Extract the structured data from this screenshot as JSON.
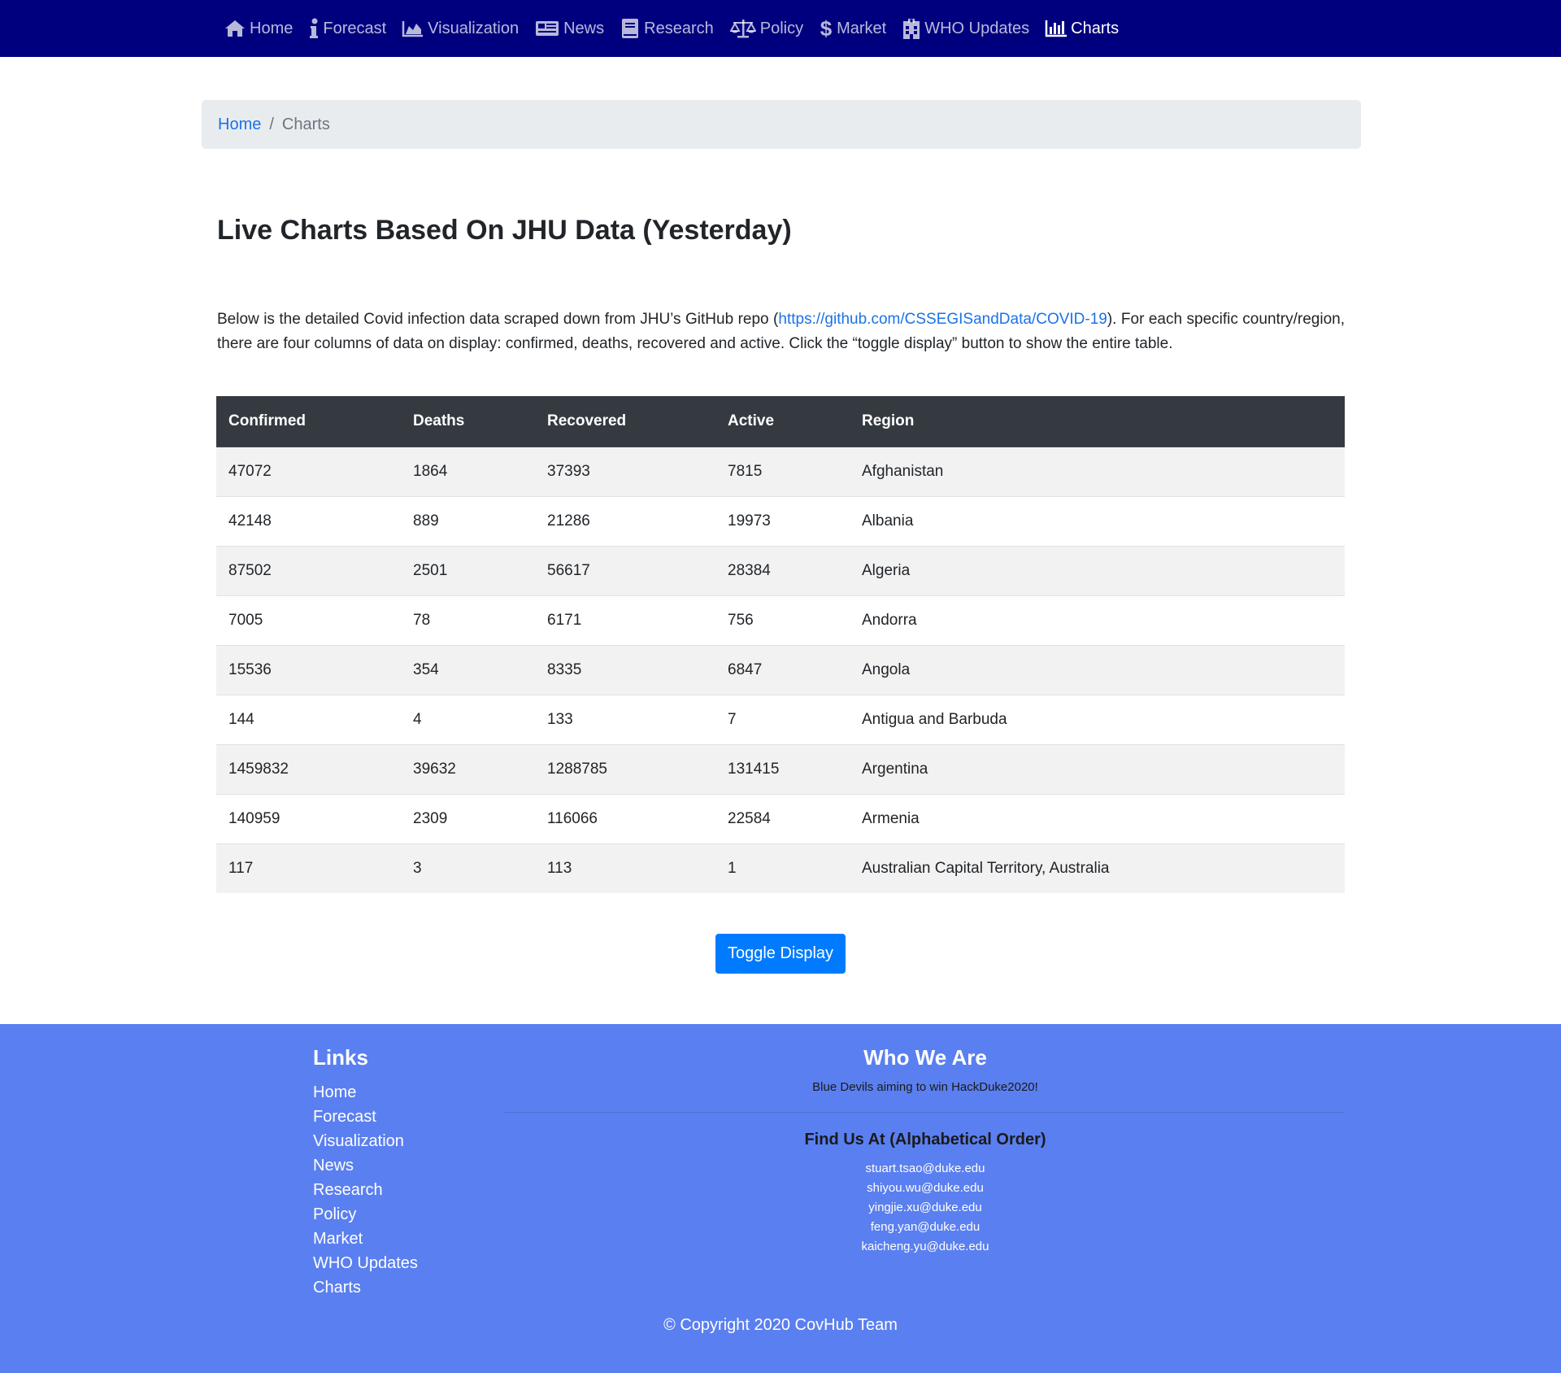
{
  "nav": {
    "items": [
      {
        "label": "Home",
        "icon": "home-icon"
      },
      {
        "label": "Forecast",
        "icon": "info-icon"
      },
      {
        "label": "Visualization",
        "icon": "area-chart-icon"
      },
      {
        "label": "News",
        "icon": "newspaper-icon"
      },
      {
        "label": "Research",
        "icon": "book-icon"
      },
      {
        "label": "Policy",
        "icon": "balance-scale-icon"
      },
      {
        "label": "Market",
        "icon": "dollar-icon"
      },
      {
        "label": "WHO Updates",
        "icon": "hospital-icon"
      },
      {
        "label": "Charts",
        "icon": "bar-chart-icon"
      }
    ],
    "active": "Charts",
    "colors": {
      "background": "#00007f",
      "text": "#bfbfdf",
      "active_text": "#ffffff"
    }
  },
  "breadcrumb": {
    "home": "Home",
    "separator": "/",
    "current": "Charts"
  },
  "page": {
    "title": "Live Charts Based On JHU Data (Yesterday)",
    "description_before": "Below is the detailed Covid infection data scraped down from JHU’s GitHub repo (",
    "description_link": "https://github.com/CSSEGISandData/COVID-19",
    "description_after": "). For each specific country/region, there are four columns of data on display: confirmed, deaths, recovered and active. Click the “toggle display” button to show the entire table."
  },
  "table": {
    "headers": [
      "Confirmed",
      "Deaths",
      "Recovered",
      "Active",
      "Region"
    ],
    "rows": [
      [
        "47072",
        "1864",
        "37393",
        "7815",
        "Afghanistan"
      ],
      [
        "42148",
        "889",
        "21286",
        "19973",
        "Albania"
      ],
      [
        "87502",
        "2501",
        "56617",
        "28384",
        "Algeria"
      ],
      [
        "7005",
        "78",
        "6171",
        "756",
        "Andorra"
      ],
      [
        "15536",
        "354",
        "8335",
        "6847",
        "Angola"
      ],
      [
        "144",
        "4",
        "133",
        "7",
        "Antigua and Barbuda"
      ],
      [
        "1459832",
        "39632",
        "1288785",
        "131415",
        "Argentina"
      ],
      [
        "140959",
        "2309",
        "116066",
        "22584",
        "Armenia"
      ],
      [
        "117",
        "3",
        "113",
        "1",
        "Australian Capital Territory, Australia"
      ]
    ]
  },
  "toggle_button": {
    "label": "Toggle Display",
    "color": "#007bff"
  },
  "footer": {
    "background": "#5a7ff0",
    "links_title": "Links",
    "links": [
      "Home",
      "Forecast",
      "Visualization",
      "News",
      "Research",
      "Policy",
      "Market",
      "WHO Updates",
      "Charts"
    ],
    "who_title": "Who We Are",
    "who_tagline": "Blue Devils aiming to win HackDuke2020!",
    "find_title": "Find Us At (Alphabetical Order)",
    "emails": [
      "stuart.tsao@duke.edu",
      "shiyou.wu@duke.edu",
      "yingjie.xu@duke.edu",
      "feng.yan@duke.edu",
      "kaicheng.yu@duke.edu"
    ],
    "copyright": "© Copyright 2020 CovHub Team"
  }
}
